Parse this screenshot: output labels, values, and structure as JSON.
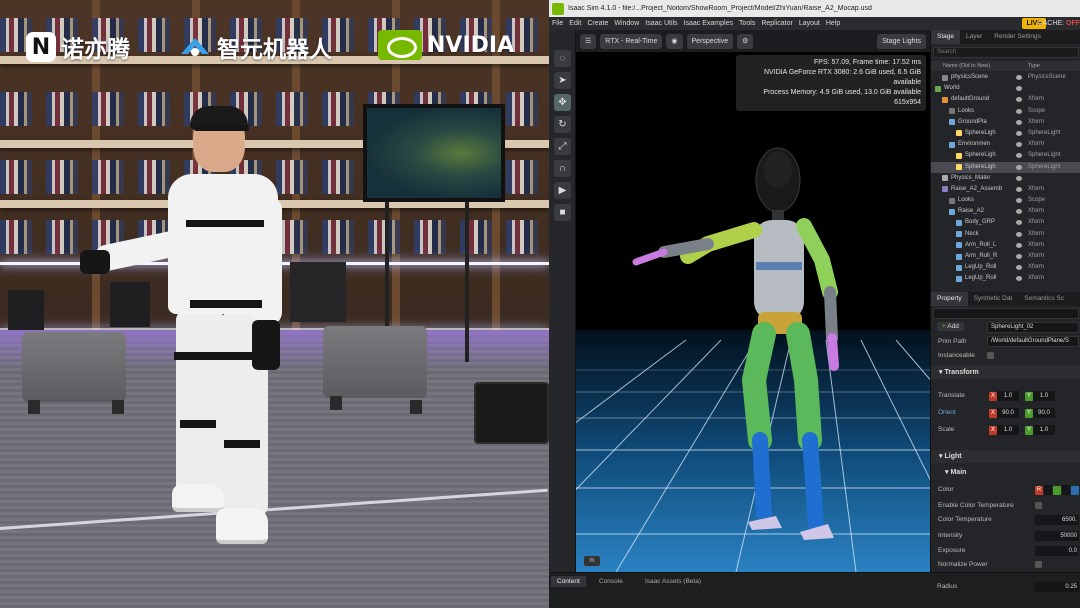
{
  "logos": {
    "noitom_letter": "N",
    "noitom_name": "诺亦腾",
    "agibot_name": "智元机器人",
    "nvidia_name": "NVIDIA"
  },
  "titlebar": {
    "title": "Isaac Sim 4.1.0 - file:/...Project_Noitom/ShowRoom_Project/Model/ZhiYuan/Raise_A2_Mocap.usd"
  },
  "menubar": {
    "items": [
      "File",
      "Edit",
      "Create",
      "Window",
      "Isaac Utils",
      "Isaac Examples",
      "Tools",
      "Replicator",
      "Layout",
      "Help"
    ],
    "live_label": "LIVE",
    "cache_label": "CACHE:",
    "cache_state": "OFF"
  },
  "viewport": {
    "render_mode": "RTX - Real-Time",
    "camera": "Perspective",
    "lights": "Stage Lights",
    "stats": {
      "line1": "FPS: 57.09, Frame time: 17.52 ms",
      "line2": "NVIDIA GeForce RTX 3080: 2.6 GiB used, 6.5 GiB available",
      "line3": "Process Memory: 4.9 GiB used, 13.0 GiB available",
      "line4": "615x954"
    },
    "corner_label": "m"
  },
  "stage": {
    "tabs": [
      "Stage",
      "Layer",
      "Render Settings"
    ],
    "search_placeholder": "Search",
    "col_name": "Name (Old to New)",
    "col_type": "Type",
    "rows": [
      {
        "name": "physicsScene",
        "type": "PhysicsScene",
        "indent": 1,
        "color": "#888"
      },
      {
        "name": "World",
        "type": "",
        "indent": 0,
        "color": "#6aa84f"
      },
      {
        "name": "defaultGround",
        "type": "Xform",
        "indent": 1,
        "color": "#e69138"
      },
      {
        "name": "Looks",
        "type": "Scope",
        "indent": 2,
        "color": "#777"
      },
      {
        "name": "GroundPla",
        "type": "Xform",
        "indent": 2,
        "color": "#6fa8dc"
      },
      {
        "name": "SphereLigh",
        "type": "SphereLight",
        "indent": 3,
        "color": "#ffd966"
      },
      {
        "name": "Environmen",
        "type": "Xform",
        "indent": 2,
        "color": "#6fa8dc"
      },
      {
        "name": "SphereLigh",
        "type": "SphereLight",
        "indent": 3,
        "color": "#ffd966"
      },
      {
        "name": "SphereLigh",
        "type": "SphereLight",
        "indent": 3,
        "color": "#ffd966",
        "selected": true
      },
      {
        "name": "Physics_Mater",
        "type": "",
        "indent": 1,
        "color": "#aaa"
      },
      {
        "name": "Raise_A2_Assemb",
        "type": "Xform",
        "indent": 1,
        "color": "#8e7cc3"
      },
      {
        "name": "Looks",
        "type": "Scope",
        "indent": 2,
        "color": "#777"
      },
      {
        "name": "Raise_A2",
        "type": "Xform",
        "indent": 2,
        "color": "#6fa8dc"
      },
      {
        "name": "Body_GRP",
        "type": "Xform",
        "indent": 3,
        "color": "#6fa8dc"
      },
      {
        "name": "Neck",
        "type": "Xform",
        "indent": 3,
        "color": "#6fa8dc"
      },
      {
        "name": "Arm_Roll_L",
        "type": "Xform",
        "indent": 3,
        "color": "#6fa8dc"
      },
      {
        "name": "Arm_Roll_R",
        "type": "Xform",
        "indent": 3,
        "color": "#6fa8dc"
      },
      {
        "name": "LegUp_Roll",
        "type": "Xform",
        "indent": 3,
        "color": "#6fa8dc"
      },
      {
        "name": "LegUp_Roll",
        "type": "Xform",
        "indent": 3,
        "color": "#6fa8dc"
      }
    ]
  },
  "property": {
    "tabs": [
      "Property",
      "Synthetic Dat",
      "Semantics Sc"
    ],
    "add_label": "Add",
    "prim_name": "SphereLight_02",
    "prim_path_label": "Prim Path",
    "prim_path": "/World/defaultGroundPlane/S",
    "instanceable_label": "Instanceable",
    "transform_header": "Transform",
    "translate_label": "Translate",
    "orient_label": "Orient",
    "scale_label": "Scale",
    "translate": [
      "1.0",
      "1.0"
    ],
    "orient": [
      "90.0",
      "90.0"
    ],
    "scale": [
      "1.0",
      "1.0"
    ],
    "light_header": "Light",
    "main_header": "Main",
    "color_label": "Color",
    "enable_temp_label": "Enable Color Temperature",
    "temp_label": "Color Temperature",
    "temp_value": "6500.",
    "intensity_label": "Intensity",
    "intensity_value": "50000",
    "exposure_label": "Exposure",
    "exposure_value": "0.0",
    "normalize_label": "Normalize Power",
    "radius_label": "Radius",
    "radius_value": "0.25",
    "axis_x": "X",
    "axis_y": "Y",
    "axis_r": "R"
  },
  "bottom": {
    "tabs": [
      "Content",
      "Console",
      "Isaac Assets (Beta)"
    ]
  },
  "colors": {
    "nvidia_green": "#76b900",
    "live_badge": "#f2b300",
    "selected_row": "#4a4b52"
  }
}
